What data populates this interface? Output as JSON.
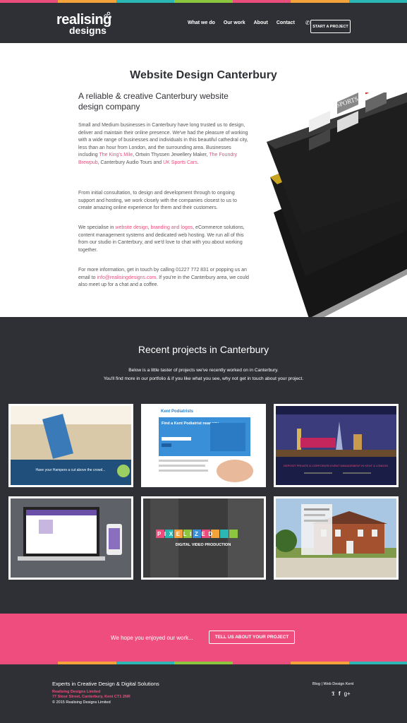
{
  "header": {
    "logo_line1": "realising",
    "logo_line2": "designs",
    "nav": [
      "What we do",
      "Our work",
      "About",
      "Contact"
    ],
    "phone_icon": "phone-icon",
    "cta": "START A PROJECT"
  },
  "intro": {
    "title": "Website Design Canterbury",
    "subtitle": "A reliable & creative Canterbury website design company",
    "p1": {
      "a": "Small and Medium businesses in Canterbury have long trusted us to design, deliver and maintain their online presence. We've had the pleasure of working with a wide range of businesses and individuals in this beautiful cathedral city, less than an hour from London, and the surrounding area. Businesses including ",
      "link1": "The King's Mile",
      "b": ", Ortwin Thyssen Jewellery Maker, ",
      "link2": "The Foundry Brewpub",
      "c": ", Canterbury Audio Tours and ",
      "link3": "UK Sports Cars",
      "d": "."
    },
    "p2": "From initial consultation, to design and development through to ongoing support and hosting, we work closely with the companies closest to us to create amazing online experience for them and their customers.",
    "p3": {
      "a": "We specialise in ",
      "link1": "website design",
      "b": ", ",
      "link2": "branding and logos",
      "c": ", eCommerce solutions, content management systems and dedicated web hosting. We run all of this from our studio in Canterbury, and we'd love to chat with you about working together."
    },
    "p4": {
      "a": "For more information, get in touch by calling 01227 772 831 or popping us an email to ",
      "link1": "info@realisingdesigns.com",
      "b": ". If you're in the Canterbury area, we could also meet up for a chat and a coffee."
    },
    "mockup_label": "UK SPORTS CARS"
  },
  "projects": {
    "title": "Recent projects in Canterbury",
    "sub1": "Below is a little taster of projects we've recently worked on in Canterbury.",
    "sub2": "You'll find more in our portfolio & if you like what you see, why not get in touch about your project.",
    "t1_caption": "Have your Hampers a cut above the crowd...",
    "t2_brand": "Kent Podiatrists",
    "t2_headline": "Find a Kent Podiatrist near you",
    "t3_banner": "DEPOSIT PRIVATE & CORPORATE EVENT MANAGEMENT IN KENT & LONDON",
    "t5_word": "PIXELIZED",
    "t5_sub": "DIGITAL VIDEO PRODUCTION"
  },
  "band": {
    "text": "We hope you enjoyed our work...",
    "button": "TELL US ABOUT YOUR PROJECT"
  },
  "footer": {
    "tagline": "Experts in Creative Design & Digital Solutions",
    "company": "Realising Designs Limited",
    "address": "77 Stour Street, Canterbury, Kent CT1 2NR",
    "copyright": "© 2015 Realising Designs Limited",
    "links": "Blog | Web Design Kent",
    "social": [
      "twitter-icon",
      "facebook-icon",
      "googleplus-icon"
    ]
  },
  "colors": {
    "dark": "#2e3035",
    "pink": "#ee4d7e",
    "stripe": [
      "#e94d7c",
      "#f3a33a",
      "#2bb7b3",
      "#8cc63f",
      "#e94d7c",
      "#f3a33a",
      "#2bb7b3"
    ]
  }
}
